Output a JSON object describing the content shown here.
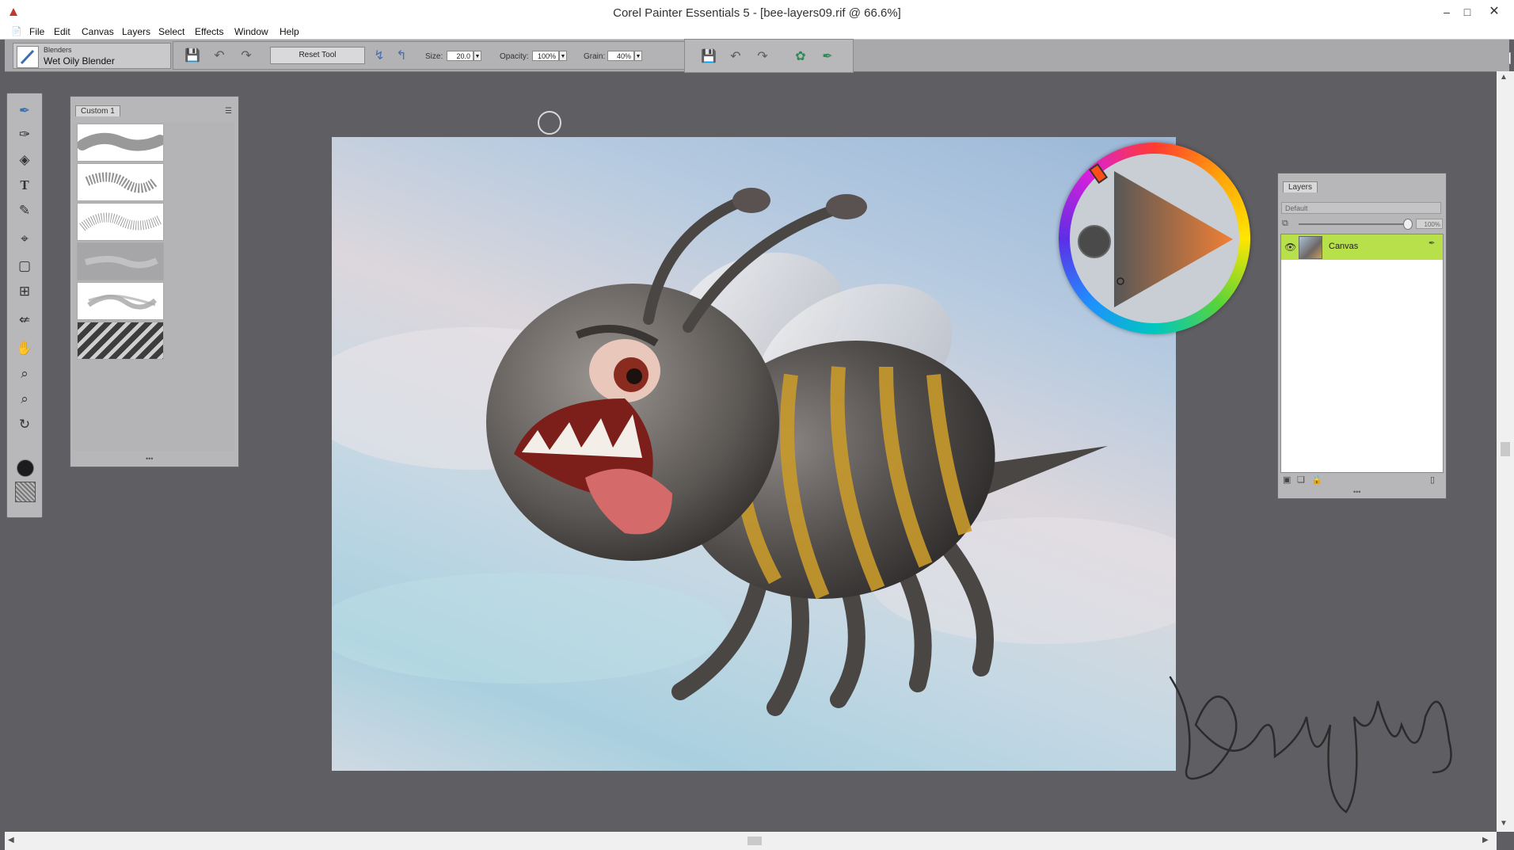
{
  "app": {
    "title": "Corel Painter Essentials 5 - [bee-layers09.rif @ 66.6%]"
  },
  "menu": [
    "File",
    "Edit",
    "Canvas",
    "Layers",
    "Select",
    "Effects",
    "Window",
    "Help"
  ],
  "brush": {
    "category": "Blenders",
    "variant": "Wet Oily Blender"
  },
  "propbar": {
    "reset_label": "Reset Tool",
    "size_label": "Size:",
    "size_value": "20.0",
    "opacity_label": "Opacity:",
    "opacity_value": "100%",
    "grain_label": "Grain:",
    "grain_value": "40%"
  },
  "brush_library": {
    "tab_label": "Custom 1",
    "stroke_count": 6
  },
  "layers": {
    "tab_label": "Layers",
    "composite_method": "Default",
    "opacity_value": "100%",
    "items": [
      {
        "name": "Canvas",
        "selected": true,
        "visible": true
      }
    ]
  },
  "colors": {
    "current_color": "#4a4a4a",
    "selected_layer": "#b8e04a",
    "background": "#5f5f63"
  }
}
